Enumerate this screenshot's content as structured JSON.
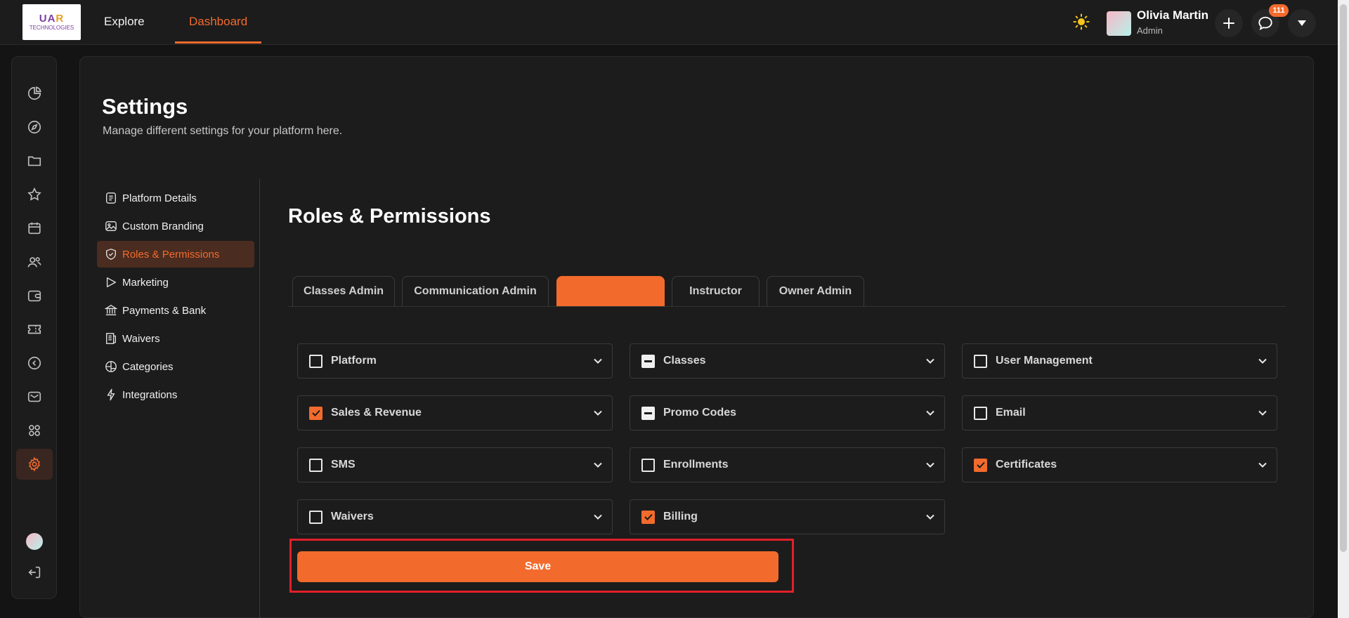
{
  "header": {
    "logo": {
      "line1_a": "UA",
      "line1_b": "R",
      "line2": "TECHNOLOGIES"
    },
    "nav": [
      {
        "label": "Explore"
      },
      {
        "label": "Dashboard"
      }
    ],
    "user": {
      "name": "Olivia Martin",
      "role": "Admin"
    },
    "notification_count": "111",
    "icons": [
      "sun-icon",
      "plus-icon",
      "chat-icon",
      "chevron-down-icon"
    ]
  },
  "rail": {
    "icons": [
      "pie-chart-icon",
      "compass-icon",
      "folder-icon",
      "star-icon",
      "calendar-icon",
      "users-icon",
      "wallet-icon",
      "ticket-icon",
      "back-circle-icon",
      "mail-icon",
      "grid-icon",
      "settings-icon",
      "logout-icon"
    ],
    "active": "settings-icon"
  },
  "page": {
    "title": "Settings",
    "subtitle": "Manage different settings for your platform here."
  },
  "settings_menu": {
    "items": [
      {
        "label": "Platform Details",
        "icon": "document-icon"
      },
      {
        "label": "Custom Branding",
        "icon": "image-icon"
      },
      {
        "label": "Roles & Permissions",
        "icon": "shield-check-icon",
        "active": true
      },
      {
        "label": "Marketing",
        "icon": "play-icon"
      },
      {
        "label": "Payments & Bank",
        "icon": "bank-icon"
      },
      {
        "label": "Waivers",
        "icon": "receipt-icon"
      },
      {
        "label": "Categories",
        "icon": "categories-icon"
      },
      {
        "label": "Integrations",
        "icon": "bolt-icon"
      }
    ]
  },
  "roles": {
    "title": "Roles & Permissions",
    "tabs": [
      {
        "label": "Classes Admin"
      },
      {
        "label": "Communication Admin"
      },
      {
        "label": "",
        "active": true
      },
      {
        "label": "Instructor"
      },
      {
        "label": "Owner Admin"
      }
    ],
    "permissions": [
      {
        "label": "Platform",
        "state": "unchecked"
      },
      {
        "label": "Classes",
        "state": "partial"
      },
      {
        "label": "User Management",
        "state": "unchecked"
      },
      {
        "label": "Sales & Revenue",
        "state": "checked"
      },
      {
        "label": "Promo Codes",
        "state": "partial"
      },
      {
        "label": "Email",
        "state": "unchecked"
      },
      {
        "label": "SMS",
        "state": "unchecked"
      },
      {
        "label": "Enrollments",
        "state": "unchecked"
      },
      {
        "label": "Certificates",
        "state": "checked"
      },
      {
        "label": "Waivers",
        "state": "unchecked"
      },
      {
        "label": "Billing",
        "state": "checked"
      }
    ],
    "save_label": "Save"
  },
  "colors": {
    "accent": "#f26b2d",
    "background": "#141414",
    "panel": "#1c1c1c",
    "highlight": "#e0202a"
  }
}
